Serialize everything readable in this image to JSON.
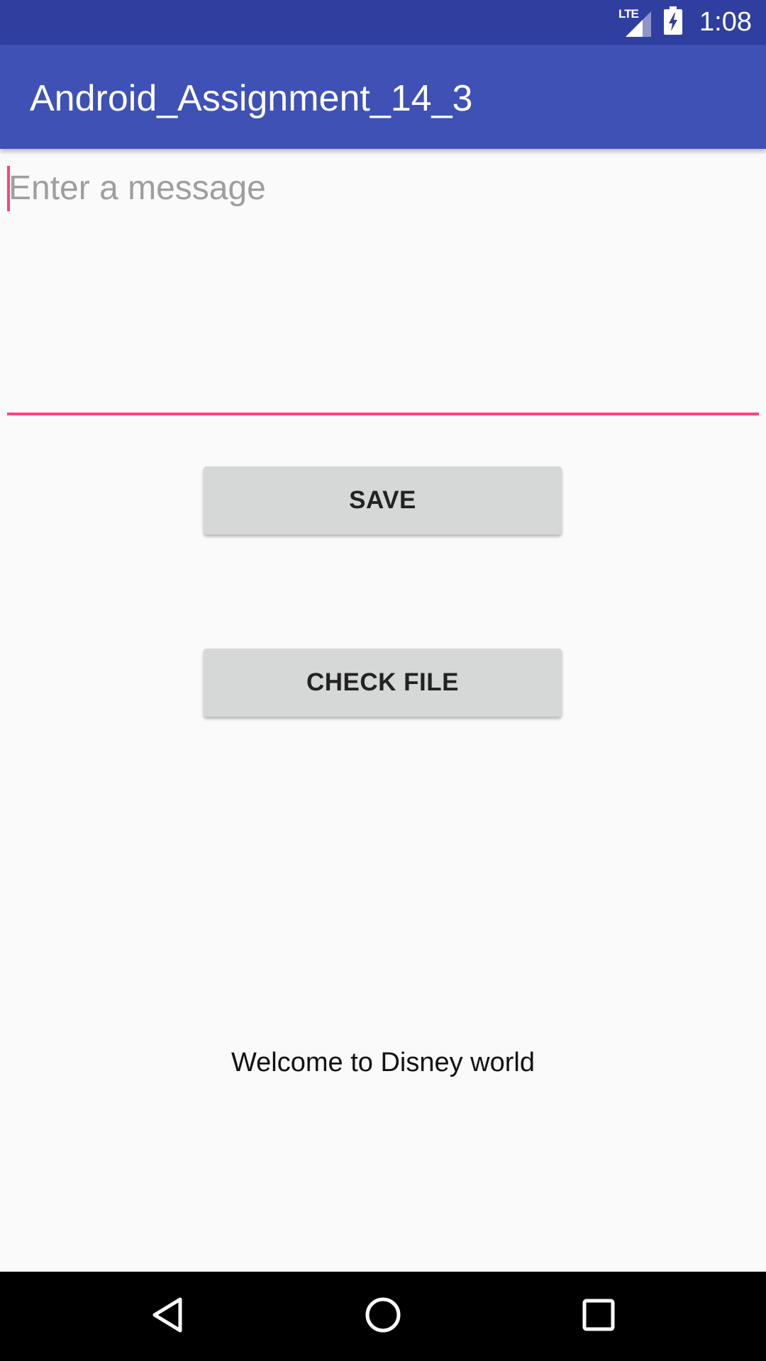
{
  "status_bar": {
    "network_label": "LTE",
    "time": "1:08"
  },
  "app_bar": {
    "title": "Android_Assignment_14_3"
  },
  "message_field": {
    "placeholder": "Enter a message",
    "value": ""
  },
  "buttons": {
    "save_label": "SAVE",
    "check_file_label": "CHECK FILE"
  },
  "welcome_text": "Welcome to Disney world",
  "nav_bar": {
    "back_icon": "back-triangle",
    "home_icon": "home-circle",
    "recents_icon": "recents-square"
  },
  "colors": {
    "status_bar": "#303F9F",
    "app_bar": "#3F51B5",
    "accent": "#FF4081",
    "button_bg": "#D6D7D7",
    "background": "#FAFAFA"
  }
}
